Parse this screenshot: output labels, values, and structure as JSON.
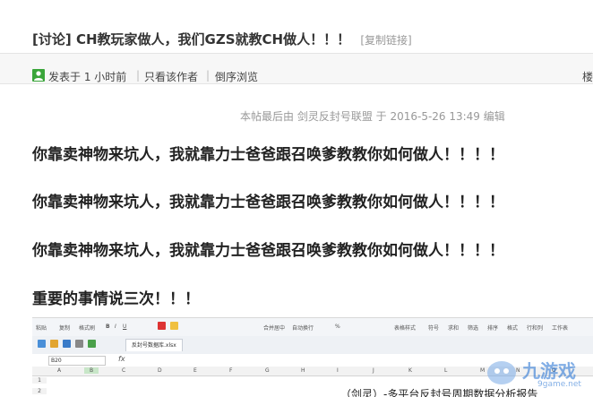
{
  "thread": {
    "tag": "[讨论]",
    "title": "CH教玩家做人，我们GZS就教CH做人！！！",
    "copy_link": "[复制链接]"
  },
  "meta": {
    "posted": "发表于 1 小时前",
    "only_author": "只看该作者",
    "reverse": "倒序浏览",
    "floor": "楼"
  },
  "post": {
    "edit_note": "本帖最后由 剑灵反封号联盟 于 2016-5-26 13:49 编辑",
    "lines": [
      "你靠卖神物来坑人，我就靠力士爸爸跟召唤爹教教你如何做人！！！！",
      "你靠卖神物来坑人，我就靠力士爸爸跟召唤爹教教你如何做人！！！！",
      "你靠卖神物来坑人，我就靠力士爸爸跟召唤爹教教你如何做人！！！！",
      "重要的事情说三次！！！"
    ]
  },
  "sheet": {
    "ribbon": [
      "粘贴",
      "复制",
      "格式刷",
      "B",
      "I",
      "U",
      "合并居中",
      "自动换行",
      "%",
      "表格样式",
      "符号",
      "求和",
      "筛选",
      "排序",
      "格式",
      "行和列",
      "工作表"
    ],
    "tab_name": "反封号数据库.xlsx",
    "cell_ref": "B20",
    "fx": "fx",
    "columns": [
      "A",
      "B",
      "C",
      "D",
      "E",
      "F",
      "G",
      "H",
      "I",
      "J",
      "K",
      "L",
      "M",
      "N",
      "O"
    ],
    "rows": [
      "1",
      "2"
    ],
    "report_title": "（剑灵）-多平台反封号周期数据分析报告"
  },
  "watermark": {
    "text": "九游戏",
    "url": "9game.net"
  },
  "colors": {
    "title": "#333333",
    "meta_bg": "#f7f7f7",
    "note": "#999999",
    "user_icon": "#3aa53a"
  }
}
